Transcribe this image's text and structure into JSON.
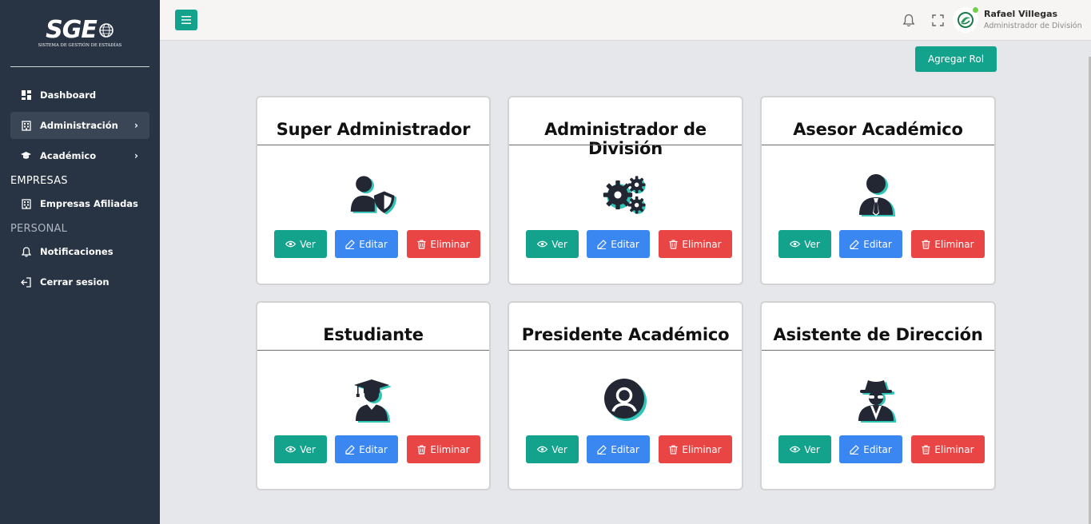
{
  "app": {
    "logo_text": "SGE",
    "logo_subtitle": "SISTEMA DE GESTIÓN DE ESTADÍAS"
  },
  "sidebar": {
    "items": [
      {
        "label": "Dashboard",
        "icon": "dashboard-icon"
      },
      {
        "label": "Administración",
        "icon": "building-icon",
        "active": true,
        "has_submenu": true
      },
      {
        "label": "Académico",
        "icon": "graduation-cap-icon",
        "has_submenu": true
      }
    ],
    "section_empresas": "EMPRESAS",
    "empresas_items": [
      {
        "label": "Empresas Afiliadas",
        "icon": "building-icon"
      }
    ],
    "section_personal": "PERSONAL",
    "personal_items": [
      {
        "label": "Notificaciones",
        "icon": "bell-icon"
      },
      {
        "label": "Cerrar sesion",
        "icon": "logout-icon"
      }
    ]
  },
  "header": {
    "user_name": "Rafael Villegas",
    "user_role": "Administrador de División",
    "status_color": "#6fd04a"
  },
  "main": {
    "add_button": "Agregar Rol",
    "buttons": {
      "view": "Ver",
      "edit": "Editar",
      "delete": "Eliminar"
    },
    "roles": [
      {
        "title": "Super Administrador",
        "icon": "user-shield-icon"
      },
      {
        "title": "Administrador de División",
        "icon": "cogs-icon"
      },
      {
        "title": "Asesor Académico",
        "icon": "user-tie-icon"
      },
      {
        "title": "Estudiante",
        "icon": "user-graduate-icon"
      },
      {
        "title": "Presidente Académico",
        "icon": "user-circle-icon"
      },
      {
        "title": "Asistente de Dirección",
        "icon": "user-secret-icon"
      }
    ]
  },
  "colors": {
    "sidebar_bg": "#283444",
    "accent": "#13a38c",
    "edit": "#3a87f2",
    "delete": "#ea4545",
    "icon_shadow": "#2ec4b6"
  }
}
